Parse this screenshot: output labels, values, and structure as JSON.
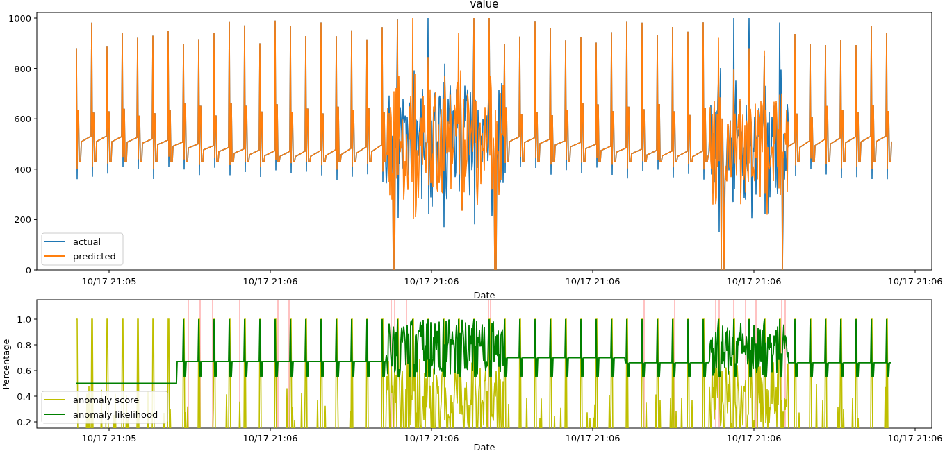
{
  "figure": {
    "title": "value"
  },
  "top_plot": {
    "xlabel": "Date",
    "yticks": [
      "1000",
      "800",
      "600",
      "400",
      "200",
      "0"
    ],
    "xticks": [
      "10/17 21:05",
      "10/17 21:06",
      "10/17 21:06",
      "10/17 21:06",
      "10/17 21:06",
      "10/17 21:06"
    ],
    "series": [
      {
        "name": "actual",
        "color": "#1f77b4"
      },
      {
        "name": "predicted",
        "color": "#ff7f0e"
      }
    ]
  },
  "bottom_plot": {
    "ylabel": "Percentage",
    "xlabel": "Date",
    "yticks": [
      "1.0",
      "0.8",
      "0.6",
      "0.4",
      "0.2"
    ],
    "xticks": [
      "10/17 21:05",
      "10/17 21:06",
      "10/17 21:06",
      "10/17 21:06",
      "10/17 21:06",
      "10/17 21:06"
    ],
    "series": [
      {
        "name": "anomaly score",
        "color": "#bfbf00"
      },
      {
        "name": "anomaly likelihood",
        "color": "#008000"
      }
    ]
  }
}
